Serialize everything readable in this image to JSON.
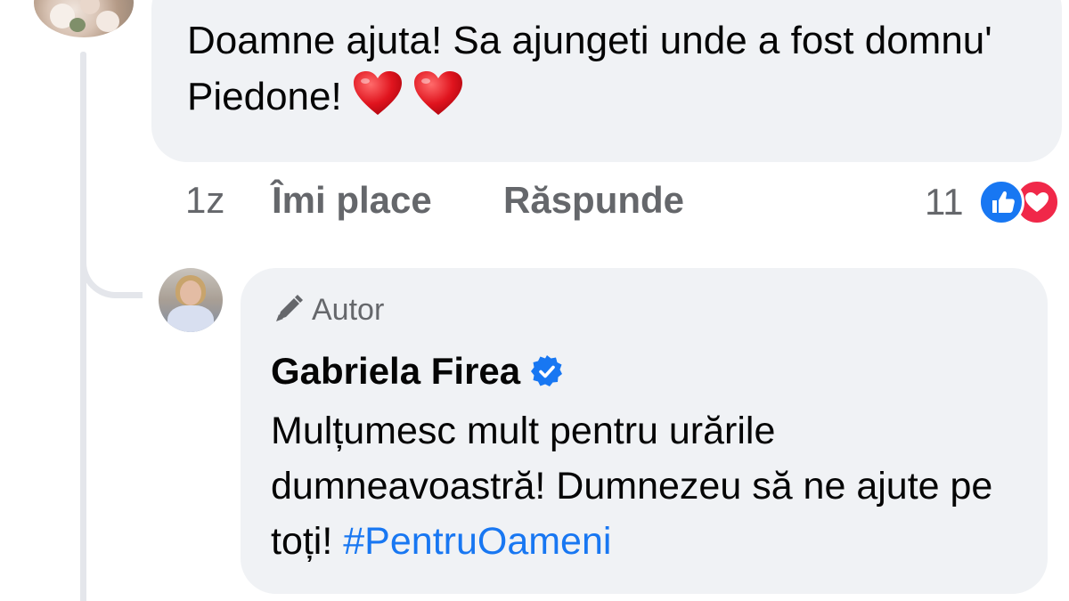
{
  "comment": {
    "text": "Doamne ajuta! Sa ajungeti unde a fost domnu' Piedone!",
    "emoji": [
      "red-heart",
      "red-heart"
    ],
    "time": "1z",
    "like_label": "Îmi place",
    "reply_label": "Răspunde",
    "reaction_count": "11",
    "reaction_types": [
      "like",
      "love"
    ]
  },
  "reply": {
    "badge_label": "Autor",
    "author_name": "Gabriela Firea",
    "verified": true,
    "text": "Mulțumesc mult pentru urările dumneavoastră! Dumnezeu să ne ajute pe toți! ",
    "hashtag": "#PentruOameni"
  },
  "colors": {
    "bubble_bg": "#f0f2f5",
    "secondary_text": "#65676b",
    "link_blue": "#1877f2",
    "love_red": "#f02849",
    "thread_line": "#e4e6eb"
  }
}
